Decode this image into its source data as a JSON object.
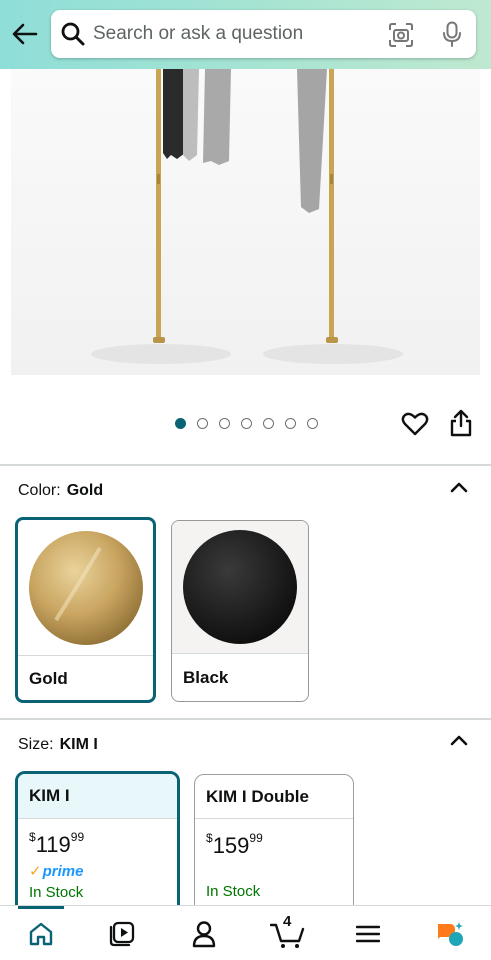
{
  "search": {
    "placeholder": "Search or ask a question"
  },
  "gallery": {
    "image_count": 7,
    "active_index": 0
  },
  "color": {
    "label": "Color:",
    "selected": "Gold",
    "options": [
      {
        "name": "Gold",
        "swatch_color": "#c9a561"
      },
      {
        "name": "Black",
        "swatch_color": "#1b1b1b"
      }
    ]
  },
  "size": {
    "label": "Size:",
    "selected": "KIM I",
    "options": [
      {
        "name": "KIM I",
        "price_symbol": "$",
        "price_whole": "119",
        "price_fraction": "99",
        "prime": "prime",
        "stock": "In Stock"
      },
      {
        "name": "KIM I Double",
        "price_symbol": "$",
        "price_whole": "159",
        "price_fraction": "99",
        "stock": "In Stock"
      }
    ]
  },
  "cart": {
    "count": "4"
  },
  "nav": [
    "home-icon",
    "video-icon",
    "account-icon",
    "cart-icon",
    "menu-icon",
    "rufus-icon"
  ],
  "colors": {
    "accent": "#0a6375",
    "in_stock": "#007600",
    "prime": "#1a98ff",
    "prime_check": "#f7a61b"
  }
}
